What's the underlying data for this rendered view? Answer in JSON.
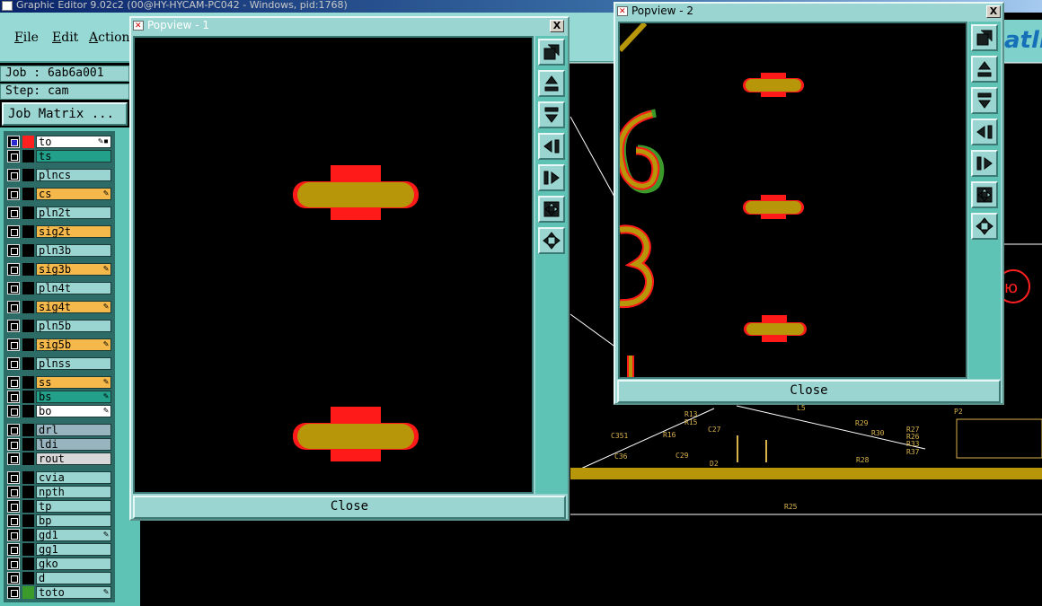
{
  "app": {
    "title": "Graphic Editor 9.02c2 (00@HY-HYCAM-PC042 - Windows, pid:1768)",
    "menu": [
      "File",
      "Edit",
      "Actions"
    ],
    "logo_text": "atlin"
  },
  "job": {
    "job_label": "Job : 6ab6a001",
    "step_label": "Step: cam",
    "matrix_button": "Job Matrix ..."
  },
  "layers": [
    {
      "name": "to",
      "color": "#ffffff",
      "flag": "✎▪",
      "swatch": "#ff2020",
      "checked": true
    },
    {
      "name": "ts",
      "color": "#22a08a",
      "flag": "",
      "swatch": "",
      "checked": false
    },
    {
      "name": "plncs",
      "color": "#9ad5d1",
      "flag": "",
      "swatch": "",
      "checked": false
    },
    {
      "name": "cs",
      "color": "#f5b84a",
      "flag": "✎",
      "swatch": "",
      "checked": false
    },
    {
      "name": "pln2t",
      "color": "#9ad5d1",
      "flag": "",
      "swatch": "",
      "checked": false
    },
    {
      "name": "sig2t",
      "color": "#f5b84a",
      "flag": "",
      "swatch": "",
      "checked": false
    },
    {
      "name": "pln3b",
      "color": "#9ad5d1",
      "flag": "",
      "swatch": "",
      "checked": false
    },
    {
      "name": "sig3b",
      "color": "#f5b84a",
      "flag": "✎",
      "swatch": "",
      "checked": false
    },
    {
      "name": "pln4t",
      "color": "#9ad5d1",
      "flag": "",
      "swatch": "",
      "checked": false
    },
    {
      "name": "sig4t",
      "color": "#f5b84a",
      "flag": "✎",
      "swatch": "",
      "checked": false
    },
    {
      "name": "pln5b",
      "color": "#9ad5d1",
      "flag": "",
      "swatch": "",
      "checked": false
    },
    {
      "name": "sig5b",
      "color": "#f5b84a",
      "flag": "✎",
      "swatch": "",
      "checked": false
    },
    {
      "name": "plnss",
      "color": "#9ad5d1",
      "flag": "",
      "swatch": "",
      "checked": false
    },
    {
      "name": "ss",
      "color": "#f5b84a",
      "flag": "✎",
      "swatch": "",
      "checked": false
    },
    {
      "name": "bs",
      "color": "#22a08a",
      "flag": "✎",
      "swatch": "",
      "checked": false
    },
    {
      "name": "bo",
      "color": "#ffffff",
      "flag": "✎",
      "swatch": "",
      "checked": false
    },
    {
      "name": "drl",
      "color": "#98b4bf",
      "flag": "",
      "swatch": "",
      "checked": false
    },
    {
      "name": "ldi",
      "color": "#98b4bf",
      "flag": "",
      "swatch": "",
      "checked": false
    },
    {
      "name": "rout",
      "color": "#d8d8d8",
      "flag": "",
      "swatch": "",
      "checked": false
    },
    {
      "name": "cvia",
      "color": "#9ad5d1",
      "flag": "",
      "swatch": "",
      "checked": false
    },
    {
      "name": "npth",
      "color": "#9ad5d1",
      "flag": "",
      "swatch": "",
      "checked": false
    },
    {
      "name": "tp",
      "color": "#9ad5d1",
      "flag": "",
      "swatch": "",
      "checked": false
    },
    {
      "name": "bp",
      "color": "#9ad5d1",
      "flag": "",
      "swatch": "",
      "checked": false
    },
    {
      "name": "gd1",
      "color": "#9ad5d1",
      "flag": "✎",
      "swatch": "",
      "checked": false
    },
    {
      "name": "gg1",
      "color": "#9ad5d1",
      "flag": "",
      "swatch": "",
      "checked": false
    },
    {
      "name": "gko",
      "color": "#9ad5d1",
      "flag": "",
      "swatch": "",
      "checked": false
    },
    {
      "name": "d",
      "color": "#9ad5d1",
      "flag": "",
      "swatch": "",
      "checked": false
    },
    {
      "name": "toto",
      "color": "#9ad5d1",
      "flag": "✎",
      "swatch": "#3a9a2a",
      "checked": false
    }
  ],
  "popview1": {
    "title": "Popview - 1",
    "close_label": "Close",
    "close_x": "X"
  },
  "popview2": {
    "title": "Popview - 2",
    "close_label": "Close",
    "close_x": "X"
  },
  "tools": [
    "zoom-window-icon",
    "pan-up-icon",
    "pan-down-icon",
    "pan-left-icon",
    "pan-right-icon",
    "zoom-fit-icon",
    "zoom-center-icon"
  ],
  "board_labels": [
    "R13",
    "R15",
    "C27",
    "C351",
    "R16",
    "C36",
    "C29",
    "D2",
    "R29",
    "R30",
    "R28",
    "R27",
    "R26",
    "R33",
    "R37",
    "P2",
    "L5",
    "R25"
  ]
}
